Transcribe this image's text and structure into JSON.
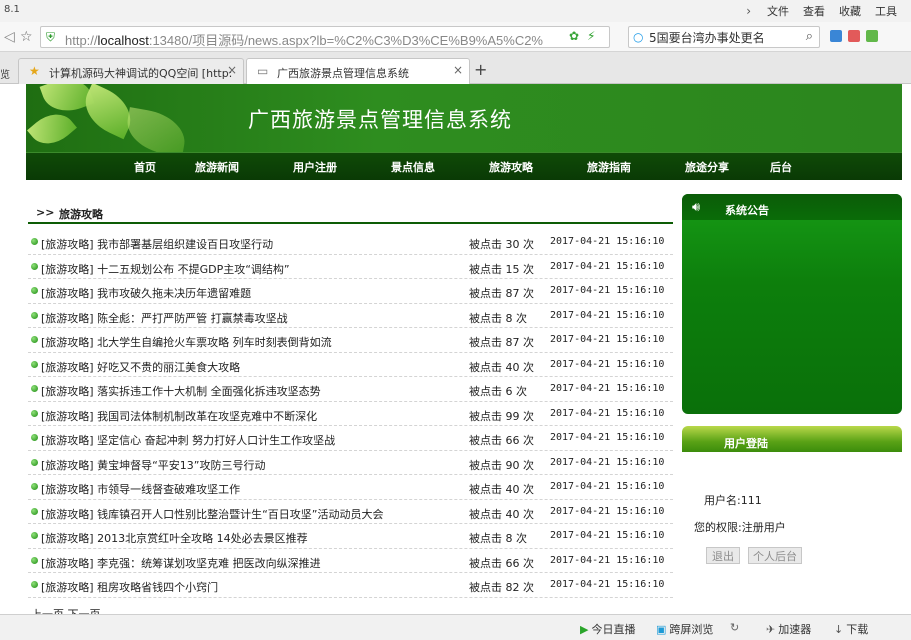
{
  "browser": {
    "version": "8.1",
    "menu": [
      "文件",
      "查看",
      "收藏",
      "工具"
    ],
    "address_prefix": "http://",
    "address_host": "localhost",
    "address_rest": ":13480/项目源码/news.aspx?lb=%C2%C3%D3%CE%B9%A5%C2%",
    "search_value": "5国要台湾办事处更名",
    "tab_left_label": "览",
    "tabs": [
      {
        "label": "计算机源码大神调试的QQ空间 [http:"
      },
      {
        "label": "广西旅游景点管理信息系统"
      }
    ]
  },
  "site": {
    "title": "广西旅游景点管理信息系统",
    "nav": [
      "首页",
      "旅游新闻",
      "用户注册",
      "景点信息",
      "旅游攻略",
      "旅游指南",
      "旅途分享",
      "后台"
    ]
  },
  "section": {
    "arrows": ">>",
    "title": "旅游攻略"
  },
  "news": [
    {
      "title": "[旅游攻略] 我市部署基层组织建设百日攻坚行动",
      "clicks": "被点击 30 次",
      "date": "2017-04-21 15:16:10"
    },
    {
      "title": "[旅游攻略] 十二五规划公布 不提GDP主攻“调结构”",
      "clicks": "被点击 15 次",
      "date": "2017-04-21 15:16:10"
    },
    {
      "title": "[旅游攻略] 我市攻破久拖未决历年遗留难题",
      "clicks": "被点击 87 次",
      "date": "2017-04-21 15:16:10"
    },
    {
      "title": "[旅游攻略] 陈全彪：严打严防严管 打赢禁毒攻坚战",
      "clicks": "被点击 8 次",
      "date": "2017-04-21 15:16:10"
    },
    {
      "title": "[旅游攻略] 北大学生自编抢火车票攻略 列车时刻表倒背如流",
      "clicks": "被点击 87 次",
      "date": "2017-04-21 15:16:10"
    },
    {
      "title": "[旅游攻略] 好吃又不贵的丽江美食大攻略",
      "clicks": "被点击 40 次",
      "date": "2017-04-21 15:16:10"
    },
    {
      "title": "[旅游攻略] 落实拆违工作十大机制 全面强化拆违攻坚态势",
      "clicks": "被点击 6 次",
      "date": "2017-04-21 15:16:10"
    },
    {
      "title": "[旅游攻略] 我国司法体制机制改革在攻坚克难中不断深化",
      "clicks": "被点击 99 次",
      "date": "2017-04-21 15:16:10"
    },
    {
      "title": "[旅游攻略] 坚定信心 奋起冲刺 努力打好人口计生工作攻坚战",
      "clicks": "被点击 66 次",
      "date": "2017-04-21 15:16:10"
    },
    {
      "title": "[旅游攻略] 黄宝坤督导“平安13”攻防三号行动",
      "clicks": "被点击 90 次",
      "date": "2017-04-21 15:16:10"
    },
    {
      "title": "[旅游攻略] 市领导一线督查破难攻坚工作",
      "clicks": "被点击 40 次",
      "date": "2017-04-21 15:16:10"
    },
    {
      "title": "[旅游攻略] 钱库镇召开人口性别比整治暨计生“百日攻坚”活动动员大会",
      "clicks": "被点击 40 次",
      "date": "2017-04-21 15:16:10"
    },
    {
      "title": "[旅游攻略] 2013北京赏红叶全攻略 14处必去景区推荐",
      "clicks": "被点击 8 次",
      "date": "2017-04-21 15:16:10"
    },
    {
      "title": "[旅游攻略] 李克强：统筹谋划攻坚克难 把医改向纵深推进",
      "clicks": "被点击 66 次",
      "date": "2017-04-21 15:16:10"
    },
    {
      "title": "[旅游攻略] 租房攻略省钱四个小窍门",
      "clicks": "被点击 82 次",
      "date": "2017-04-21 15:16:10"
    }
  ],
  "pager": "上一页 下一页",
  "sidebar": {
    "notice_title": "系统公告",
    "login_title": "用户登陆",
    "username": "用户名:111",
    "role": "您的权限:注册用户",
    "logout_label": "退出",
    "admin_label": "个人后台"
  },
  "statusbar": [
    "今日直播",
    "跨屏浏览",
    "加速器",
    "下载"
  ]
}
